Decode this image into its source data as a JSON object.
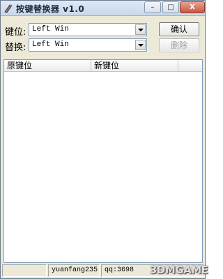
{
  "window": {
    "title": "按键替换器 v1.0",
    "controls": {
      "minimize": "–",
      "maximize": "□",
      "close": "X"
    }
  },
  "form": {
    "key_label": "键位:",
    "key_value": "Left Win",
    "replace_label": "替换:",
    "replace_value": "Left Win",
    "confirm_label": "确认",
    "delete_label": "删除"
  },
  "list": {
    "columns": [
      "原键位",
      "新键位"
    ],
    "rows": []
  },
  "status": {
    "author": "yuanfang235",
    "qq": "qq:3698"
  },
  "watermark": {
    "text": "3DMGAME"
  }
}
